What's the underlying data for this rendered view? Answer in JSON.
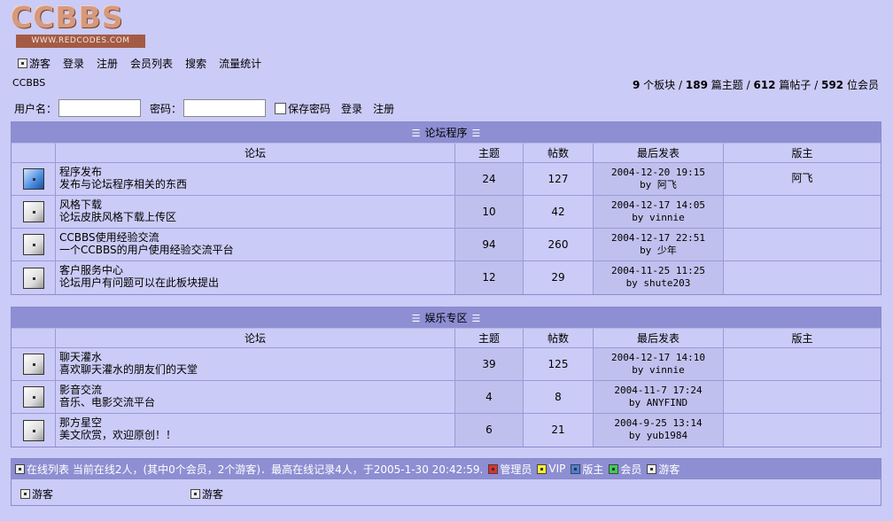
{
  "logo": {
    "title": "CCBBS",
    "url_text": "WWW.REDCODES.COM"
  },
  "topnav": [
    {
      "label": "游客",
      "icon": "guest-icon"
    },
    {
      "label": "登录"
    },
    {
      "label": "注册"
    },
    {
      "label": "会员列表"
    },
    {
      "label": "搜索"
    },
    {
      "label": "流量统计"
    }
  ],
  "forum_name": "CCBBS",
  "stats": {
    "boards": "9",
    "boards_unit": "个板块",
    "topics": "189",
    "topics_unit": "篇主题",
    "posts": "612",
    "posts_unit": "篇帖子",
    "members": "592",
    "members_unit": "位会员",
    "sep": "/"
  },
  "login": {
    "username_label": "用户名：",
    "password_label": "密码：",
    "remember_label": "保存密码",
    "login_button": "登录",
    "register_button": "注册"
  },
  "columns": {
    "forum": "论坛",
    "topics": "主题",
    "posts": "帖数",
    "last": "最后发表",
    "mod": "版主"
  },
  "categories": [
    {
      "title": "论坛程序",
      "forums": [
        {
          "name": "程序发布",
          "desc": "发布与论坛程序相关的东西",
          "topics": "24",
          "posts": "127",
          "last_time": "2004-12-20 19:15",
          "last_by": "by 阿飞",
          "mod": "阿飞",
          "new": true
        },
        {
          "name": "风格下载",
          "desc": "论坛皮肤风格下载上传区",
          "topics": "10",
          "posts": "42",
          "last_time": "2004-12-17 14:05",
          "last_by": "by vinnie",
          "mod": "",
          "new": false
        },
        {
          "name": "CCBBS使用经验交流",
          "desc": "一个CCBBS的用户使用经验交流平台",
          "topics": "94",
          "posts": "260",
          "last_time": "2004-12-17 22:51",
          "last_by": "by 少年",
          "mod": "",
          "new": false
        },
        {
          "name": "客户服务中心",
          "desc": "论坛用户有问题可以在此板块提出",
          "topics": "12",
          "posts": "29",
          "last_time": "2004-11-25 11:25",
          "last_by": "by shute203",
          "mod": "",
          "new": false
        }
      ]
    },
    {
      "title": "娱乐专区",
      "forums": [
        {
          "name": "聊天灌水",
          "desc": "喜欢聊天灌水的朋友们的天堂",
          "topics": "39",
          "posts": "125",
          "last_time": "2004-12-17 14:10",
          "last_by": "by vinnie",
          "mod": "",
          "new": false
        },
        {
          "name": "影音交流",
          "desc": "音乐、电影交流平台",
          "topics": "4",
          "posts": "8",
          "last_time": "2004-11-7 17:24",
          "last_by": "by ANYFIND",
          "mod": "",
          "new": false
        },
        {
          "name": "那方星空",
          "desc": "美文欣赏，欢迎原创！！",
          "topics": "6",
          "posts": "21",
          "last_time": "2004-9-25 13:14",
          "last_by": "by yub1984",
          "mod": "",
          "new": false
        }
      ]
    }
  ],
  "online": {
    "text": "在线列表 当前在线2人，(其中0个会员，2个游客)．最高在线记录4人，于2005-1-30 20:42:59.",
    "legend": [
      {
        "label": "管理员",
        "color": "#e03030"
      },
      {
        "label": "VIP",
        "color": "#ffee33"
      },
      {
        "label": "版主",
        "color": "#4a7fe0"
      },
      {
        "label": "会员",
        "color": "#3ccc5a"
      },
      {
        "label": "游客",
        "color": "#eeeeee"
      }
    ],
    "users": [
      "游客",
      "游客"
    ]
  }
}
